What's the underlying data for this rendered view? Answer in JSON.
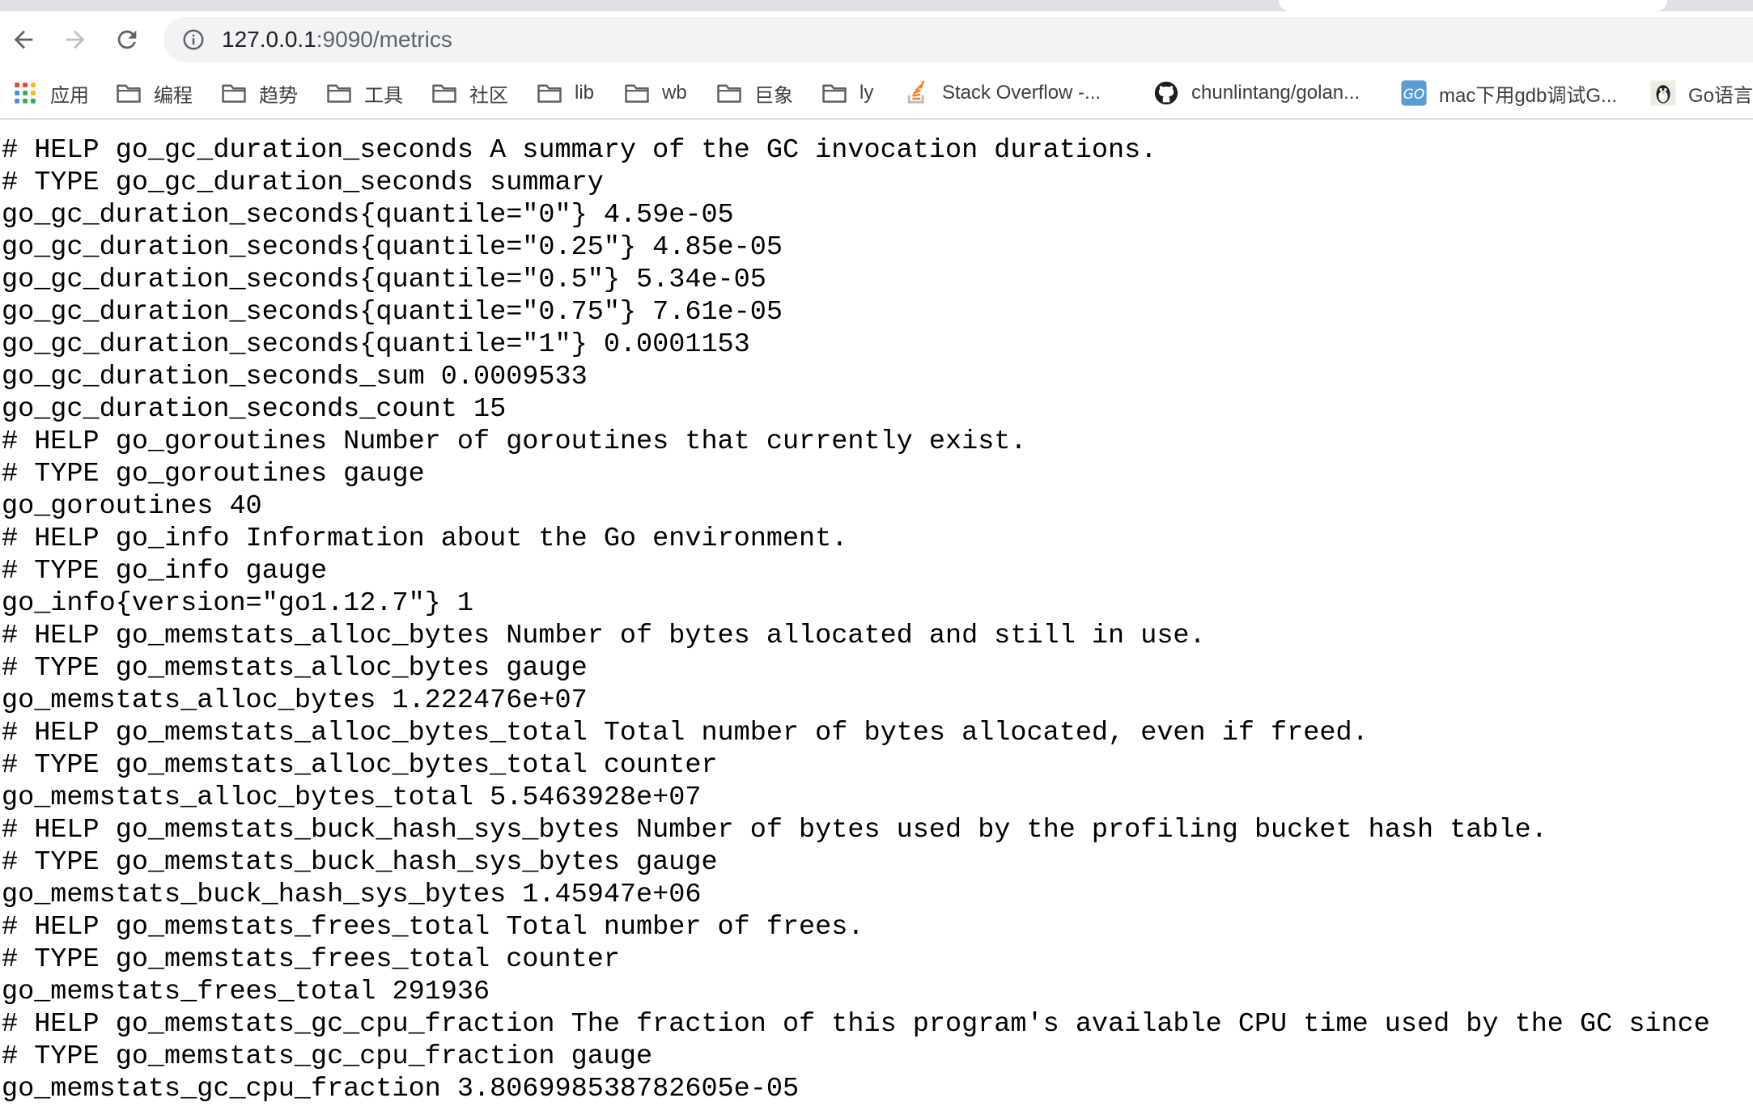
{
  "browser": {
    "url_host": "127.0.0.1",
    "url_rest": ":9090/metrics",
    "icons": {
      "back": "back-arrow-icon",
      "forward": "forward-arrow-icon",
      "reload": "reload-icon",
      "info": "site-info-icon"
    }
  },
  "bookmarks": [
    {
      "label": "应用",
      "icon": "apps-grid-icon"
    },
    {
      "label": "编程",
      "icon": "folder-icon"
    },
    {
      "label": "趋势",
      "icon": "folder-icon"
    },
    {
      "label": "工具",
      "icon": "folder-icon"
    },
    {
      "label": "社区",
      "icon": "folder-icon"
    },
    {
      "label": "lib",
      "icon": "folder-icon"
    },
    {
      "label": "wb",
      "icon": "folder-icon"
    },
    {
      "label": "巨象",
      "icon": "folder-icon"
    },
    {
      "label": "ly",
      "icon": "folder-icon"
    },
    {
      "label": "Stack Overflow -...",
      "icon": "stackoverflow-icon"
    },
    {
      "label": "chunlintang/golan...",
      "icon": "github-icon"
    },
    {
      "label": "mac下用gdb调试G...",
      "icon": "go-favicon"
    },
    {
      "label": "Go语言",
      "icon": "penguin-favicon"
    }
  ],
  "metrics_lines": [
    "# HELP go_gc_duration_seconds A summary of the GC invocation durations.",
    "# TYPE go_gc_duration_seconds summary",
    "go_gc_duration_seconds{quantile=\"0\"} 4.59e-05",
    "go_gc_duration_seconds{quantile=\"0.25\"} 4.85e-05",
    "go_gc_duration_seconds{quantile=\"0.5\"} 5.34e-05",
    "go_gc_duration_seconds{quantile=\"0.75\"} 7.61e-05",
    "go_gc_duration_seconds{quantile=\"1\"} 0.0001153",
    "go_gc_duration_seconds_sum 0.0009533",
    "go_gc_duration_seconds_count 15",
    "# HELP go_goroutines Number of goroutines that currently exist.",
    "# TYPE go_goroutines gauge",
    "go_goroutines 40",
    "# HELP go_info Information about the Go environment.",
    "# TYPE go_info gauge",
    "go_info{version=\"go1.12.7\"} 1",
    "# HELP go_memstats_alloc_bytes Number of bytes allocated and still in use.",
    "# TYPE go_memstats_alloc_bytes gauge",
    "go_memstats_alloc_bytes 1.222476e+07",
    "# HELP go_memstats_alloc_bytes_total Total number of bytes allocated, even if freed.",
    "# TYPE go_memstats_alloc_bytes_total counter",
    "go_memstats_alloc_bytes_total 5.5463928e+07",
    "# HELP go_memstats_buck_hash_sys_bytes Number of bytes used by the profiling bucket hash table.",
    "# TYPE go_memstats_buck_hash_sys_bytes gauge",
    "go_memstats_buck_hash_sys_bytes 1.45947e+06",
    "# HELP go_memstats_frees_total Total number of frees.",
    "# TYPE go_memstats_frees_total counter",
    "go_memstats_frees_total 291936",
    "# HELP go_memstats_gc_cpu_fraction The fraction of this program's available CPU time used by the GC since",
    "# TYPE go_memstats_gc_cpu_fraction gauge",
    "go_memstats_gc_cpu_fraction 3.806998538782605e-05"
  ]
}
